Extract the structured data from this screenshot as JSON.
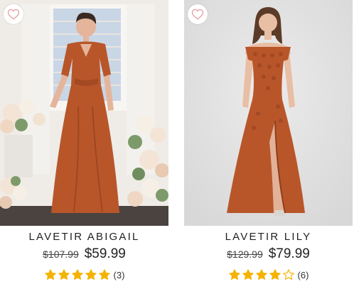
{
  "colors": {
    "star": "#f5b301",
    "dress": "#b8562a",
    "heart": "#e6a2a6"
  },
  "products": [
    {
      "name": "LAVETIR ABIGAIL",
      "old_price": "$107.99",
      "price": "$59.99",
      "rating": 5,
      "stars_filled": 5,
      "stars_total": 5,
      "review_count": "(3)",
      "image": "model-in-rust-chiffon-flutter-sleeve-gown-with-flowers",
      "favorite_icon": "heart-outline-icon"
    },
    {
      "name": "LAVETIR LILY",
      "old_price": "$129.99",
      "price": "$79.99",
      "rating": 4,
      "stars_filled": 4,
      "stars_total": 5,
      "review_count": "(6)",
      "image": "model-in-rust-off-shoulder-lace-gown-with-slit",
      "favorite_icon": "heart-outline-icon"
    }
  ]
}
